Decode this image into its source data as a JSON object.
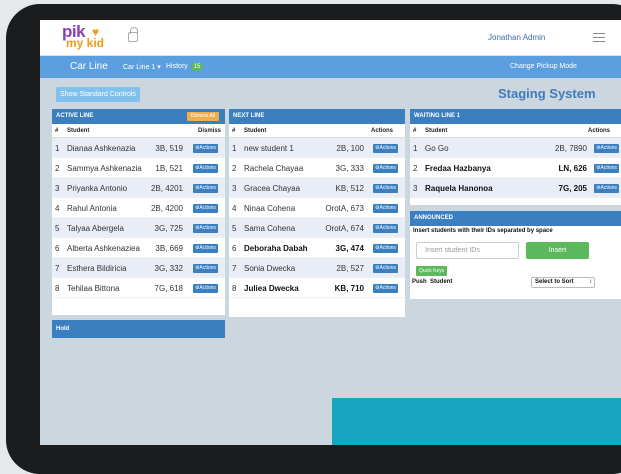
{
  "header": {
    "logo_text_top": "pik",
    "logo_text_bottom": "my kid",
    "user_name": "Jonathan Admin"
  },
  "nav": {
    "title": "Car Line",
    "car_line_dropdown": "Car Line 1 ▾",
    "history_label": "History",
    "history_count": "15",
    "change_mode": "Change Pickup Mode"
  },
  "controls": {
    "show_standard_controls": "Show Standard Controls",
    "page_title": "Staging System"
  },
  "active_line": {
    "title": "ACTIVE LINE",
    "dismiss_all": "Dismiss All",
    "col_num": "#",
    "col_student": "Student",
    "col_dismiss": "Dismiss",
    "rows": [
      {
        "num": "1",
        "name": "Dianaa Ashkenazia",
        "room": "3B, 519",
        "action": "Actions"
      },
      {
        "num": "2",
        "name": "Sammya Ashkenazia",
        "room": "1B, 521",
        "action": "Actions"
      },
      {
        "num": "3",
        "name": "Priyanka Antonio",
        "room": "2B, 4201",
        "action": "Actions"
      },
      {
        "num": "4",
        "name": "Rahul Antonia",
        "room": "2B, 4200",
        "action": "Actions"
      },
      {
        "num": "5",
        "name": "Talyaa Abergela",
        "room": "3G, 725",
        "action": "Actions"
      },
      {
        "num": "6",
        "name": "Alberta Ashkenaziea",
        "room": "3B, 669",
        "action": "Actions"
      },
      {
        "num": "7",
        "name": "Esthera Bildiricia",
        "room": "3G, 332",
        "action": "Actions"
      },
      {
        "num": "8",
        "name": "Tehilaa Bittona",
        "room": "7G, 618",
        "action": "Actions"
      }
    ]
  },
  "hold": {
    "title": "Hold"
  },
  "next_line": {
    "title": "NEXT LINE",
    "col_num": "#",
    "col_student": "Student",
    "col_actions": "Actions",
    "rows": [
      {
        "num": "1",
        "name": "new student 1",
        "room": "2B, 100",
        "action": "Actions"
      },
      {
        "num": "2",
        "name": "Rachela Chayaa",
        "room": "3G, 333",
        "action": "Actions"
      },
      {
        "num": "3",
        "name": "Gracea Chayaa",
        "room": "KB, 512",
        "action": "Actions"
      },
      {
        "num": "4",
        "name": "Ninaa Cohena",
        "room": "OrotA, 673",
        "action": "Actions"
      },
      {
        "num": "5",
        "name": "Sama Cohena",
        "room": "OrotA, 674",
        "action": "Actions"
      },
      {
        "num": "6",
        "name": "Deboraha Dabah",
        "room": "3G, 474",
        "action": "Actions"
      },
      {
        "num": "7",
        "name": "Sonia Dwecka",
        "room": "2B, 527",
        "action": "Actions"
      },
      {
        "num": "8",
        "name": "Juliea Dwecka",
        "room": "KB, 710",
        "action": "Actions"
      }
    ]
  },
  "waiting_line": {
    "title": "WAITING LINE 1",
    "col_num": "#",
    "col_student": "Student",
    "col_actions": "Actions",
    "rows": [
      {
        "num": "1",
        "name": "Go Go",
        "room": "2B, 7890",
        "action": "Actions"
      },
      {
        "num": "2",
        "name": "Fredaa Hazbanya",
        "room": "LN, 626",
        "action": "Actions"
      },
      {
        "num": "3",
        "name": "Raquela Hanonoa",
        "room": "7G, 205",
        "action": "Actions"
      }
    ]
  },
  "announced": {
    "title": "ANNOUNCED",
    "instructions": "Insert students with their IDs separated by space",
    "input_placeholder": "Insert student IDs",
    "insert_button": "Insert",
    "quick_keys": "Quick Keys",
    "col_push": "Push",
    "col_student": "Student",
    "sort_select": "Select to Sort"
  },
  "colors": {
    "nav_blue": "#5b9fe0",
    "panel_header_blue": "#3a7fc0",
    "accent_teal": "#18a5bf",
    "insert_green": "#5cb85c",
    "dismiss_orange": "#f0ad4e"
  }
}
